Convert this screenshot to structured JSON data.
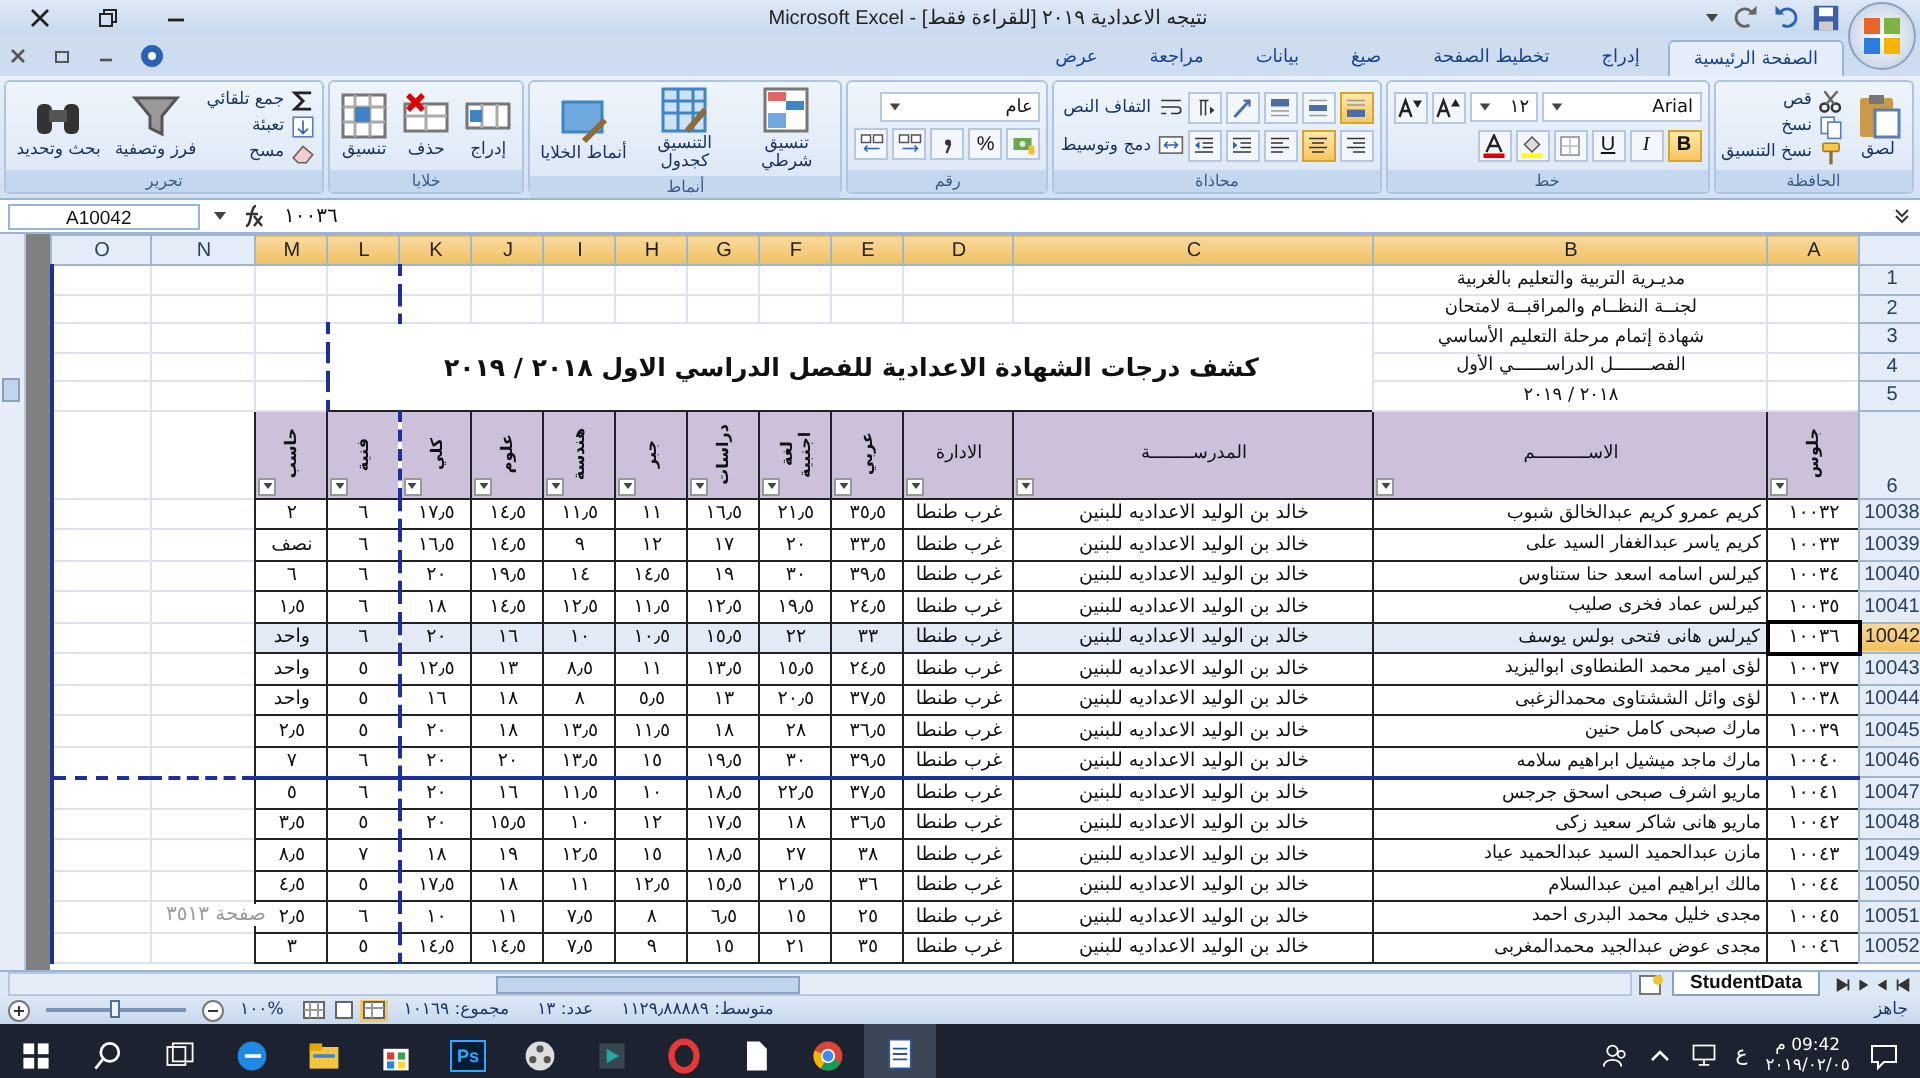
{
  "window": {
    "title": "نتيجه الاعدادية ٢٠١٩ [للقراءة فقط] - Microsoft Excel"
  },
  "ribbon": {
    "tabs": [
      {
        "label": "الصفحة الرئيسية",
        "selected": true
      },
      {
        "label": "إدراج",
        "selected": false
      },
      {
        "label": "تخطيط الصفحة",
        "selected": false
      },
      {
        "label": "صيغ",
        "selected": false
      },
      {
        "label": "بيانات",
        "selected": false
      },
      {
        "label": "مراجعة",
        "selected": false
      },
      {
        "label": "عرض",
        "selected": false
      }
    ],
    "groups": [
      {
        "title": "الحافظة",
        "kind": "columns",
        "lines": [
          [
            {
              "kind": "large",
              "label": "لصق"
            }
          ],
          [
            {
              "kind": "small",
              "label": "قص"
            },
            {
              "kind": "small",
              "label": "نسخ"
            },
            {
              "kind": "small",
              "label": "نسخ التنسيق"
            }
          ]
        ]
      },
      {
        "title": "خط",
        "kind": "rows",
        "lines": [
          [
            {
              "kind": "combo",
              "value": "Arial"
            },
            {
              "kind": "combo",
              "value": "١٢"
            },
            {
              "kind": "tool",
              "selected": false
            },
            {
              "kind": "tool",
              "selected": false
            }
          ],
          [
            {
              "kind": "glyph",
              "label": "B",
              "selected": true
            },
            {
              "kind": "glyph",
              "label": "I",
              "selected": false
            },
            {
              "kind": "glyph",
              "label": "U",
              "selected": false
            },
            {
              "kind": "tool",
              "selected": false
            },
            {
              "kind": "tool",
              "selected": false
            },
            {
              "kind": "tool",
              "selected": false
            }
          ]
        ]
      },
      {
        "title": "محاذاة",
        "kind": "rows",
        "lines": [
          [
            {
              "kind": "tool",
              "selected": true
            },
            {
              "kind": "tool",
              "selected": false
            },
            {
              "kind": "tool",
              "selected": false
            },
            {
              "kind": "tool",
              "selected": false
            },
            {
              "kind": "tool",
              "selected": false
            },
            {
              "kind": "small",
              "label": "التفاف النص"
            }
          ],
          [
            {
              "kind": "tool",
              "selected": false
            },
            {
              "kind": "tool",
              "selected": true
            },
            {
              "kind": "tool",
              "selected": false
            },
            {
              "kind": "tool",
              "selected": false
            },
            {
              "kind": "tool",
              "selected": false
            },
            {
              "kind": "small",
              "label": "دمج وتوسيط"
            }
          ]
        ]
      },
      {
        "title": "رقم",
        "kind": "rows",
        "lines": [
          [
            {
              "kind": "combo",
              "value": "عام"
            }
          ],
          [
            {
              "kind": "tool",
              "selected": false
            },
            {
              "kind": "glyph",
              "label": "%",
              "selected": false
            },
            {
              "kind": "tool",
              "selected": false
            },
            {
              "kind": "tool",
              "selected": false
            },
            {
              "kind": "tool",
              "selected": false
            }
          ]
        ]
      },
      {
        "title": "أنماط",
        "kind": "columns",
        "lines": [
          [
            {
              "kind": "large",
              "label": "تنسيق شرطي"
            }
          ],
          [
            {
              "kind": "large",
              "label": "التنسيق كجدول"
            }
          ],
          [
            {
              "kind": "large",
              "label": "أنماط الخلايا"
            }
          ]
        ]
      },
      {
        "title": "خلايا",
        "kind": "columns",
        "lines": [
          [
            {
              "kind": "large",
              "label": "إدراج"
            }
          ],
          [
            {
              "kind": "large",
              "label": "حذف"
            }
          ],
          [
            {
              "kind": "large",
              "label": "تنسيق"
            }
          ]
        ]
      },
      {
        "title": "تحرير",
        "kind": "columns",
        "lines": [
          [
            {
              "kind": "small",
              "label": "جمع تلقائي"
            },
            {
              "kind": "small",
              "label": "تعبئة"
            },
            {
              "kind": "small",
              "label": "مسح"
            }
          ],
          [
            {
              "kind": "large",
              "label": "فرز وتصفية"
            }
          ],
          [
            {
              "kind": "large",
              "label": "بحث وتحديد"
            }
          ]
        ]
      }
    ]
  },
  "formula_bar": {
    "name_box": "A10042",
    "formula": "١٠٠٣٦"
  },
  "sheet": {
    "columns": [
      {
        "letter": "A",
        "selected": true
      },
      {
        "letter": "B",
        "selected": true
      },
      {
        "letter": "C",
        "selected": true
      },
      {
        "letter": "D",
        "selected": true
      },
      {
        "letter": "E",
        "selected": true
      },
      {
        "letter": "F",
        "selected": true
      },
      {
        "letter": "G",
        "selected": true
      },
      {
        "letter": "H",
        "selected": true
      },
      {
        "letter": "I",
        "selected": true
      },
      {
        "letter": "J",
        "selected": true
      },
      {
        "letter": "K",
        "selected": true
      },
      {
        "letter": "L",
        "selected": true
      },
      {
        "letter": "M",
        "selected": true
      },
      {
        "letter": "N",
        "selected": false
      },
      {
        "letter": "O",
        "selected": false
      }
    ],
    "row_numbers": [
      "1",
      "2",
      "3",
      "4",
      "5",
      "6"
    ],
    "header_lines": [
      "مديـرية التربية والتعليم بالغربية",
      "لجنــة النظــام والمراقبــة لامتحان",
      "شهادة إتمام مرحلة التعليم الأساسي",
      "الفصـــــــل الدراســــــي الأول",
      "٢٠١٨ / ٢٠١٩"
    ],
    "title": "كشف درجات الشهادة الاعدادية للفصل الدراسي الاول ٢٠١٨ / ٢٠١٩",
    "headings": [
      {
        "text": "جلوس",
        "kind": "vertical"
      },
      {
        "text": "الاســــــــــم",
        "kind": "plain"
      },
      {
        "text": "المدرســــــــة",
        "kind": "plain"
      },
      {
        "text": "الادارة",
        "kind": "plain"
      },
      {
        "text": "عربي",
        "kind": "vertical"
      },
      {
        "text": "لغة اجنبية",
        "kind": "vertical"
      },
      {
        "text": "دراسات",
        "kind": "vertical"
      },
      {
        "text": "جبر",
        "kind": "vertical"
      },
      {
        "text": "هندسة",
        "kind": "vertical"
      },
      {
        "text": "علوم",
        "kind": "vertical"
      },
      {
        "text": "كلي",
        "kind": "vertical"
      },
      {
        "text": "فنية",
        "kind": "vertical"
      },
      {
        "text": "حاسب",
        "kind": "vertical"
      }
    ],
    "rows": [
      {
        "number": "10038",
        "selected": false,
        "cells": [
          "١٠٠٣٢",
          "كريم عمرو كريم عبدالخالق شبوب",
          "خالد بن الوليد الاعداديه للبنين",
          "غرب طنطا",
          "٣٥٫٥",
          "٢١٫٥",
          "١٦٫٥",
          "١١",
          "١١٫٥",
          "١٤٫٥",
          "١٧٫٥",
          "٦",
          "٢"
        ]
      },
      {
        "number": "10039",
        "selected": false,
        "cells": [
          "١٠٠٣٣",
          "كريم ياسر عبدالغفار السيد على",
          "خالد بن الوليد الاعداديه للبنين",
          "غرب طنطا",
          "٣٣٫٥",
          "٢٠",
          "١٧",
          "١٢",
          "٩",
          "١٤٫٥",
          "١٦٫٥",
          "٦",
          "نصف"
        ]
      },
      {
        "number": "10040",
        "selected": false,
        "cells": [
          "١٠٠٣٤",
          "كيرلس اسامه اسعد حنا ستناوس",
          "خالد بن الوليد الاعداديه للبنين",
          "غرب طنطا",
          "٣٩٫٥",
          "٣٠",
          "١٩",
          "١٤٫٥",
          "١٤",
          "١٩٫٥",
          "٢٠",
          "٦",
          "٦"
        ]
      },
      {
        "number": "10041",
        "selected": false,
        "cells": [
          "١٠٠٣٥",
          "كيرلس عماد فخرى صليب",
          "خالد بن الوليد الاعداديه للبنين",
          "غرب طنطا",
          "٢٤٫٥",
          "١٩٫٥",
          "١٢٫٥",
          "١١٫٥",
          "١٢٫٥",
          "١٤٫٥",
          "١٨",
          "٦",
          "١٫٥"
        ]
      },
      {
        "number": "10042",
        "selected": true,
        "cells": [
          "١٠٠٣٦",
          "كيرلس هانى فتحى بولس يوسف",
          "خالد بن الوليد الاعداديه للبنين",
          "غرب طنطا",
          "٣٣",
          "٢٢",
          "١٥٫٥",
          "١٠٫٥",
          "١٠",
          "١٦",
          "٢٠",
          "٦",
          "واحد"
        ]
      },
      {
        "number": "10043",
        "selected": false,
        "cells": [
          "١٠٠٣٧",
          "لؤى امير محمد الطنطاوى ابواليزيد",
          "خالد بن الوليد الاعداديه للبنين",
          "غرب طنطا",
          "٢٤٫٥",
          "١٥٫٥",
          "١٣٫٥",
          "١١",
          "٨٫٥",
          "١٣",
          "١٢٫٥",
          "٥",
          "واحد"
        ]
      },
      {
        "number": "10044",
        "selected": false,
        "cells": [
          "١٠٠٣٨",
          "لؤى وائل الششتاوى محمدالزغبى",
          "خالد بن الوليد الاعداديه للبنين",
          "غرب طنطا",
          "٣٧٫٥",
          "٢٠٫٥",
          "١٣",
          "٥٫٥",
          "٨",
          "١٨",
          "١٦",
          "٥",
          "واحد"
        ]
      },
      {
        "number": "10045",
        "selected": false,
        "cells": [
          "١٠٠٣٩",
          "مارك صبحى كامل حنين",
          "خالد بن الوليد الاعداديه للبنين",
          "غرب طنطا",
          "٣٦٫٥",
          "٢٨",
          "١٨",
          "١١٫٥",
          "١٣٫٥",
          "١٨",
          "٢٠",
          "٥",
          "٢٫٥"
        ]
      },
      {
        "number": "10046",
        "selected": false,
        "cells": [
          "١٠٠٤٠",
          "مارك ماجد ميشيل ابراهيم سلامه",
          "خالد بن الوليد الاعداديه للبنين",
          "غرب طنطا",
          "٣٩٫٥",
          "٣٠",
          "١٩٫٥",
          "١٥",
          "١٣٫٥",
          "٢٠",
          "٢٠",
          "٦",
          "٧"
        ]
      },
      {
        "number": "10047",
        "selected": false,
        "cells": [
          "١٠٠٤١",
          "ماريو اشرف صبحى اسحق جرجس",
          "خالد بن الوليد الاعداديه للبنين",
          "غرب طنطا",
          "٣٧٫٥",
          "٢٢٫٥",
          "١٨٫٥",
          "١٠",
          "١١٫٥",
          "١٦",
          "٢٠",
          "٦",
          "٥"
        ]
      },
      {
        "number": "10048",
        "selected": false,
        "cells": [
          "١٠٠٤٢",
          "ماريو هانى شاكر سعيد زكى",
          "خالد بن الوليد الاعداديه للبنين",
          "غرب طنطا",
          "٣٦٫٥",
          "١٨",
          "١٧٫٥",
          "١٢",
          "١٠",
          "١٥٫٥",
          "٢٠",
          "٥",
          "٣٫٥"
        ]
      },
      {
        "number": "10049",
        "selected": false,
        "cells": [
          "١٠٠٤٣",
          "مازن عبدالحميد السيد عبدالحميد عياد",
          "خالد بن الوليد الاعداديه للبنين",
          "غرب طنطا",
          "٣٨",
          "٢٧",
          "١٨٫٥",
          "١٥",
          "١٢٫٥",
          "١٩",
          "١٨",
          "٧",
          "٨٫٥"
        ]
      },
      {
        "number": "10050",
        "selected": false,
        "cells": [
          "١٠٠٤٤",
          "مالك ابراهيم امين عبدالسلام",
          "خالد بن الوليد الاعداديه للبنين",
          "غرب طنطا",
          "٣٦",
          "٢١٫٥",
          "١٥٫٥",
          "١٢٫٥",
          "١١",
          "١٨",
          "١٧٫٥",
          "٥",
          "٤٫٥"
        ]
      },
      {
        "number": "10051",
        "selected": false,
        "cells": [
          "١٠٠٤٥",
          "مجدى خليل محمد البدرى احمد",
          "خالد بن الوليد الاعداديه للبنين",
          "غرب طنطا",
          "٢٥",
          "١٥",
          "٦٫٥",
          "٨",
          "٧٫٥",
          "١١",
          "١٠",
          "٦",
          "٢٫٥"
        ]
      },
      {
        "number": "10052",
        "selected": false,
        "cells": [
          "١٠٠٤٦",
          "مجدى عوض عبدالجيد محمدالمغربى",
          "خالد بن الوليد الاعداديه للبنين",
          "غرب طنطا",
          "٣٥",
          "٢١",
          "١٥",
          "٩",
          "٧٫٥",
          "١٤٫٥",
          "١٤٫٥",
          "٥",
          "٣"
        ]
      }
    ],
    "page_label": "صفحة ٣٥١٣"
  },
  "sheet_tabs": [
    {
      "label": "StudentData",
      "selected": true
    }
  ],
  "status_bar": {
    "mode": "جاهز",
    "stats": [
      "متوسط: ١١٢٩٫٨٨٨٨٩",
      "عدد: ١٣",
      "مجموع: ١٠١٦٩"
    ],
    "views": [
      {
        "selected": true
      },
      {
        "selected": false
      },
      {
        "selected": false
      }
    ],
    "zoom": "%١٠٠",
    "zoom_slider": {
      "level": 0.5
    }
  },
  "taskbar": {
    "apps": [
      {
        "selected": false
      },
      {
        "selected": false
      },
      {
        "selected": false
      },
      {
        "selected": false
      },
      {
        "selected": false
      },
      {
        "selected": false
      },
      {
        "label": "Ps",
        "selected": false
      },
      {
        "selected": false
      },
      {
        "selected": false
      },
      {
        "selected": false
      },
      {
        "selected": false
      },
      {
        "selected": false
      },
      {
        "selected": true
      }
    ],
    "language": "ع",
    "time": "09:42 م",
    "date": "٢٠١٩/٠٢/٠٥"
  }
}
